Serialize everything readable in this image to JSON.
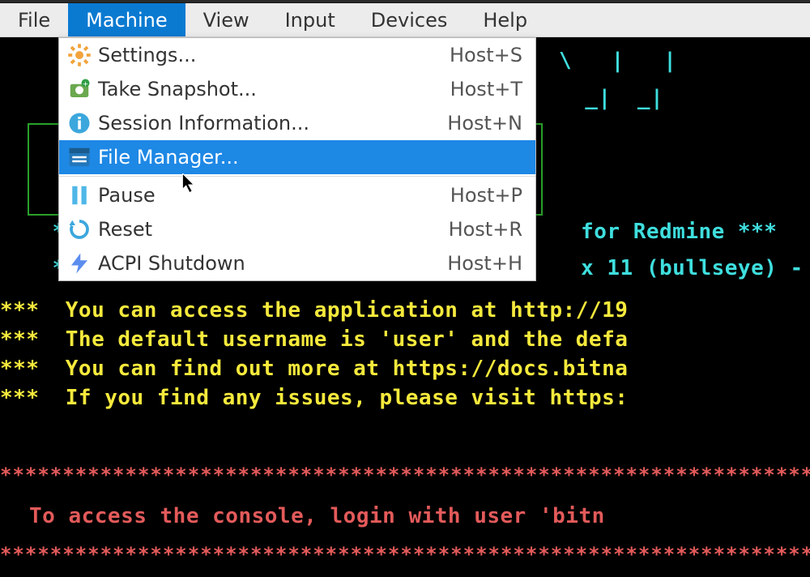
{
  "menubar": {
    "items": [
      {
        "label": "File",
        "active": false
      },
      {
        "label": "Machine",
        "active": true
      },
      {
        "label": "View",
        "active": false
      },
      {
        "label": "Input",
        "active": false
      },
      {
        "label": "Devices",
        "active": false
      },
      {
        "label": "Help",
        "active": false
      }
    ]
  },
  "dropdown": {
    "items": [
      {
        "icon": "gear",
        "label": "Settings...",
        "shortcut": "Host+S"
      },
      {
        "icon": "camera",
        "label": "Take Snapshot...",
        "shortcut": "Host+T"
      },
      {
        "icon": "info",
        "label": "Session Information...",
        "shortcut": "Host+N"
      },
      {
        "icon": "fileman",
        "label": "File Manager...",
        "shortcut": "",
        "hover": true
      },
      {
        "sep": true
      },
      {
        "icon": "pause",
        "label": "Pause",
        "shortcut": "Host+P"
      },
      {
        "icon": "reset",
        "label": "Reset",
        "shortcut": "Host+R"
      },
      {
        "icon": "power",
        "label": "ACPI Shutdown",
        "shortcut": "Host+H"
      }
    ]
  },
  "console": {
    "ascii_art_right_fragments": [
      "\\   |   |",
      "  _|  _|"
    ],
    "cyan_stars": "***",
    "yellow_stars": "***",
    "red_star_line": "*****************************************************************",
    "cyan_lines": [
      "for Redmine ***",
      "x 11 (bullseye) -"
    ],
    "yellow_lines": [
      "You can access the application at http://19",
      "The default username is 'user' and the defa",
      "You can find out more at https://docs.bitna",
      "If you find any issues, please visit https:"
    ],
    "red_lines": [
      "To access the console, login with user 'bitn"
    ]
  },
  "colors": {
    "cyan": "#3fdede",
    "yellow": "#f5e93c",
    "red": "#e35a5a",
    "menu_highlight": "#0a7ad1",
    "dropdown_hover": "#1e88e5",
    "green_box": "#2aa12a"
  }
}
